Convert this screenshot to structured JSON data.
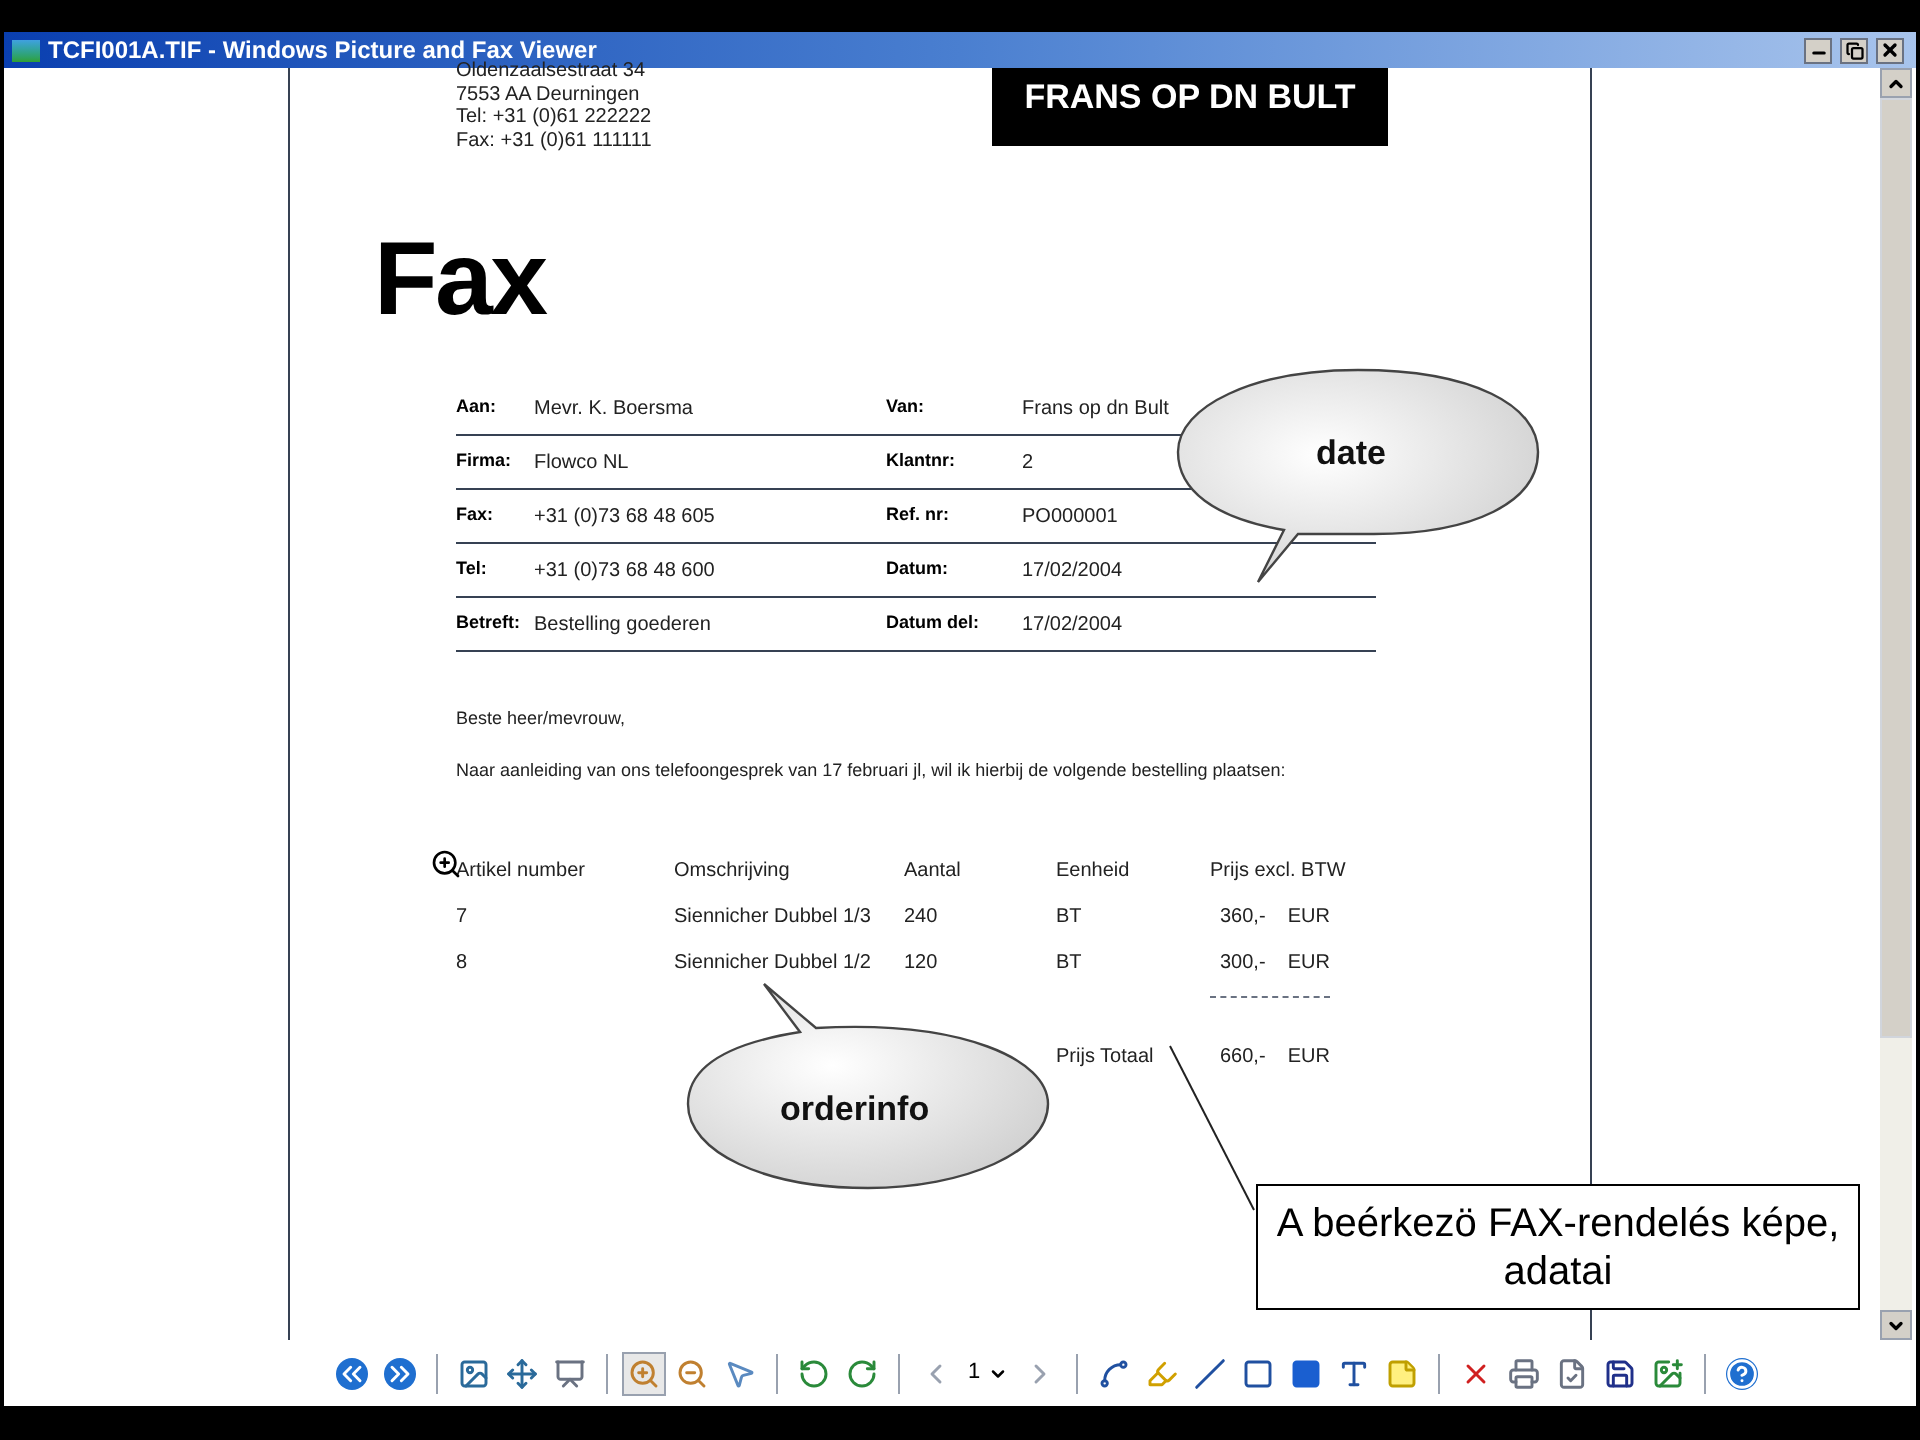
{
  "window": {
    "title": "TCFI001A.TIF - Windows Picture and Fax Viewer"
  },
  "document": {
    "address": [
      "Oldenzaalsestraat 34",
      "7553 AA Deurningen",
      "Tel: +31 (0)61 222222",
      "Fax: +31 (0)61 111111"
    ],
    "logo": "FRANS OP DN BULT",
    "heading": "Fax",
    "fields": [
      {
        "label": "Aan:",
        "value": "Mevr. K. Boersma",
        "label_2": "Van:",
        "value_2": "Frans op dn Bult"
      },
      {
        "label": "Firma:",
        "value": "Flowco NL",
        "label_2": "Klantnr:",
        "value_2": "2"
      },
      {
        "label": "Fax:",
        "value": "+31 (0)73 68 48 605",
        "label_2": "Ref. nr:",
        "value_2": "PO000001"
      },
      {
        "label": "Tel:",
        "value": "+31 (0)73 68 48 600",
        "label_2": "Datum:",
        "value_2": "17/02/2004"
      },
      {
        "label": "Betreft:",
        "value": "Bestelling goederen",
        "label_2": "Datum del:",
        "value_2": "17/02/2004"
      }
    ],
    "greeting": "Beste heer/mevrouw,",
    "body": "Naar aanleiding van ons telefoongesprek van 17 februari jl, wil ik hierbij de volgende bestelling plaatsen:",
    "table": {
      "columns": [
        "Artikel number",
        "Omschrijving",
        "Aantal",
        "Eenheid",
        "Prijs excl. BTW"
      ],
      "rows": [
        [
          "7",
          "Siennicher Dubbel 1/3",
          "240",
          "BT",
          "360,-",
          "EUR"
        ],
        [
          "8",
          "Siennicher Dubbel 1/2",
          "120",
          "BT",
          "300,-",
          "EUR"
        ]
      ],
      "total": {
        "label": "Prijs Totaal",
        "amount": "660,-",
        "currency": "EUR"
      }
    }
  },
  "callouts": [
    {
      "text": "date"
    },
    {
      "text": "orderinfo"
    }
  ],
  "caption": "A beérkezö FAX-rendelés képe, adatai",
  "toolbar": {
    "tools": [
      {
        "kind": "previous",
        "selected": false
      },
      {
        "kind": "next",
        "selected": false
      },
      {
        "kind": "sep"
      },
      {
        "kind": "best-fit",
        "selected": false
      },
      {
        "kind": "actual-size",
        "selected": false
      },
      {
        "kind": "slideshow",
        "selected": false
      },
      {
        "kind": "sep"
      },
      {
        "kind": "zoom-in",
        "selected": true
      },
      {
        "kind": "zoom-out",
        "selected": false
      },
      {
        "kind": "pointer",
        "selected": false
      },
      {
        "kind": "sep"
      },
      {
        "kind": "rotate-left",
        "selected": false
      },
      {
        "kind": "rotate-right",
        "selected": false
      },
      {
        "kind": "sep"
      },
      {
        "kind": "page-prev",
        "selected": false
      },
      {
        "kind": "page-number",
        "value": "1"
      },
      {
        "kind": "page-next",
        "selected": false
      },
      {
        "kind": "sep"
      },
      {
        "kind": "freehand",
        "selected": false
      },
      {
        "kind": "highlighter",
        "selected": false
      },
      {
        "kind": "line",
        "selected": false
      },
      {
        "kind": "frame",
        "selected": false
      },
      {
        "kind": "filled-frame",
        "selected": false
      },
      {
        "kind": "text",
        "selected": false
      },
      {
        "kind": "note",
        "selected": false
      },
      {
        "kind": "sep"
      },
      {
        "kind": "delete",
        "selected": false
      },
      {
        "kind": "print",
        "selected": false
      },
      {
        "kind": "copy",
        "selected": false
      },
      {
        "kind": "save",
        "selected": false
      },
      {
        "kind": "edit",
        "selected": false
      },
      {
        "kind": "sep"
      },
      {
        "kind": "help",
        "selected": false
      }
    ]
  }
}
